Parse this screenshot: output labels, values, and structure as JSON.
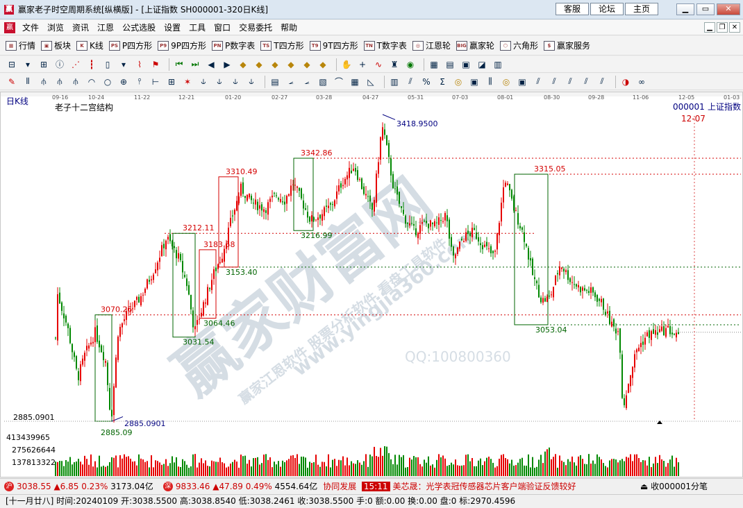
{
  "titlebar": {
    "icon": "赢",
    "title": "赢家老子时空周期系统[纵横版] - [上证指数  SH000001-320日K线]",
    "links": [
      "客服",
      "论坛",
      "主页"
    ],
    "buttons": [
      "▁",
      "▭",
      "✕"
    ]
  },
  "menubar": {
    "items": [
      "文件",
      "浏览",
      "资讯",
      "江恩",
      "公式选股",
      "设置",
      "工具",
      "窗口",
      "交易委托",
      "帮助"
    ],
    "mdi_buttons": [
      "▁",
      "❐",
      "✕"
    ]
  },
  "toolbar": {
    "items": [
      {
        "icon": "grid-icon",
        "label": "行情",
        "tag": "▦"
      },
      {
        "icon": "blocks-icon",
        "label": "板块",
        "tag": "▣"
      },
      {
        "icon": "candle-icon",
        "label": "K线",
        "tag": "K"
      },
      {
        "icon": "p-square-icon",
        "label": "P四方形",
        "tag": "PS"
      },
      {
        "icon": "9p-square-icon",
        "label": "9P四方形",
        "tag": "P9"
      },
      {
        "icon": "pn-table-icon",
        "label": "P数字表",
        "tag": "PN"
      },
      {
        "icon": "t-square-icon",
        "label": "T四方形",
        "tag": "TS"
      },
      {
        "icon": "9t-square-icon",
        "label": "9T四方形",
        "tag": "T9"
      },
      {
        "icon": "tn-table-icon",
        "label": "T数字表",
        "tag": "TN"
      },
      {
        "icon": "gann-wheel-icon",
        "label": "江恩轮",
        "tag": "◎"
      },
      {
        "icon": "winner-wheel-icon",
        "label": "赢家轮",
        "tag": "BIG"
      },
      {
        "icon": "hexagon-icon",
        "label": "六角形",
        "tag": "⬡"
      },
      {
        "icon": "dollar-icon",
        "label": "赢家服务",
        "tag": "$"
      }
    ]
  },
  "chart": {
    "period_label": "日K线",
    "indicator_name": "老子十二宫结构",
    "code": "000001",
    "name": "上证指数",
    "cursor_date": "12-07",
    "date_ticks": [
      "09-16",
      "10-24",
      "11-22",
      "12-21",
      "01-20",
      "02-27",
      "03-28",
      "04-27",
      "05-31",
      "07-03",
      "08-01",
      "08-30",
      "09-28",
      "11-06",
      "12-05",
      "01-03"
    ],
    "price_axis_low": "2885.0901",
    "volume_ticks": [
      "413439965",
      "275626644",
      "137813322"
    ],
    "watermark": {
      "brand": "赢家财富网",
      "line1": "赢家江恩软件 股票分析软件 看盘工具软件",
      "url": "www.yingjia360.com",
      "qq": "QQ:100800360"
    },
    "annotations": [
      {
        "label": "3418.9500",
        "color": "blue"
      },
      {
        "label": "3342.86",
        "color": "red"
      },
      {
        "label": "3315.05",
        "color": "red"
      },
      {
        "label": "3310.49",
        "color": "red"
      },
      {
        "label": "3216.99",
        "color": "green"
      },
      {
        "label": "3212.11",
        "color": "red"
      },
      {
        "label": "3183.58",
        "color": "red"
      },
      {
        "label": "3153.40",
        "color": "green"
      },
      {
        "label": "3070.25",
        "color": "red"
      },
      {
        "label": "3064.46",
        "color": "green"
      },
      {
        "label": "3053.04",
        "color": "green"
      },
      {
        "label": "3031.54",
        "color": "green"
      },
      {
        "label": "2885.0901",
        "color": "blue"
      },
      {
        "label": "2885.09",
        "color": "green"
      }
    ]
  },
  "chart_data": {
    "type": "candlestick",
    "title": "老子十二宫结构",
    "series": [
      {
        "name": "上证指数"
      }
    ],
    "ylim": [
      2885.0901,
      3418.95
    ],
    "key_highs": [
      3418.95,
      3342.86,
      3315.05,
      3310.49,
      3212.11,
      3183.58,
      3070.25
    ],
    "key_lows": [
      3216.99,
      3153.4,
      3064.46,
      3053.04,
      3031.54,
      2885.09
    ],
    "volume_ticks": [
      413439965,
      275626644,
      137813322
    ]
  },
  "statusbar": {
    "sh_icon": "沪",
    "sh_price": "3038.55",
    "sh_change": "▲6.85",
    "sh_pct": "0.23%",
    "sh_amount": "3173.04亿",
    "sz_icon": "深",
    "sz_price": "9833.46",
    "sz_change": "▲47.89",
    "sz_pct": "0.49%",
    "sz_amount": "4554.64亿",
    "news_prefix": "协同发展",
    "news_time": "15:11",
    "news_text": "美芯晟：光学表冠传感器芯片客户端验证反馈较好",
    "right": "收000001分笔"
  },
  "infobar": {
    "text": "[十一月廿八] 时间:20240109 开:3038.5500 高:3038.8540 低:3038.2461 收:3038.5500 手:0 额:0.00 换:0.00 盘:0 标:2970.4596"
  },
  "colors": {
    "up": "#e60000",
    "down": "#008800",
    "red_line": "#d40000",
    "green_line": "#006400",
    "blue_text": "#000080"
  }
}
